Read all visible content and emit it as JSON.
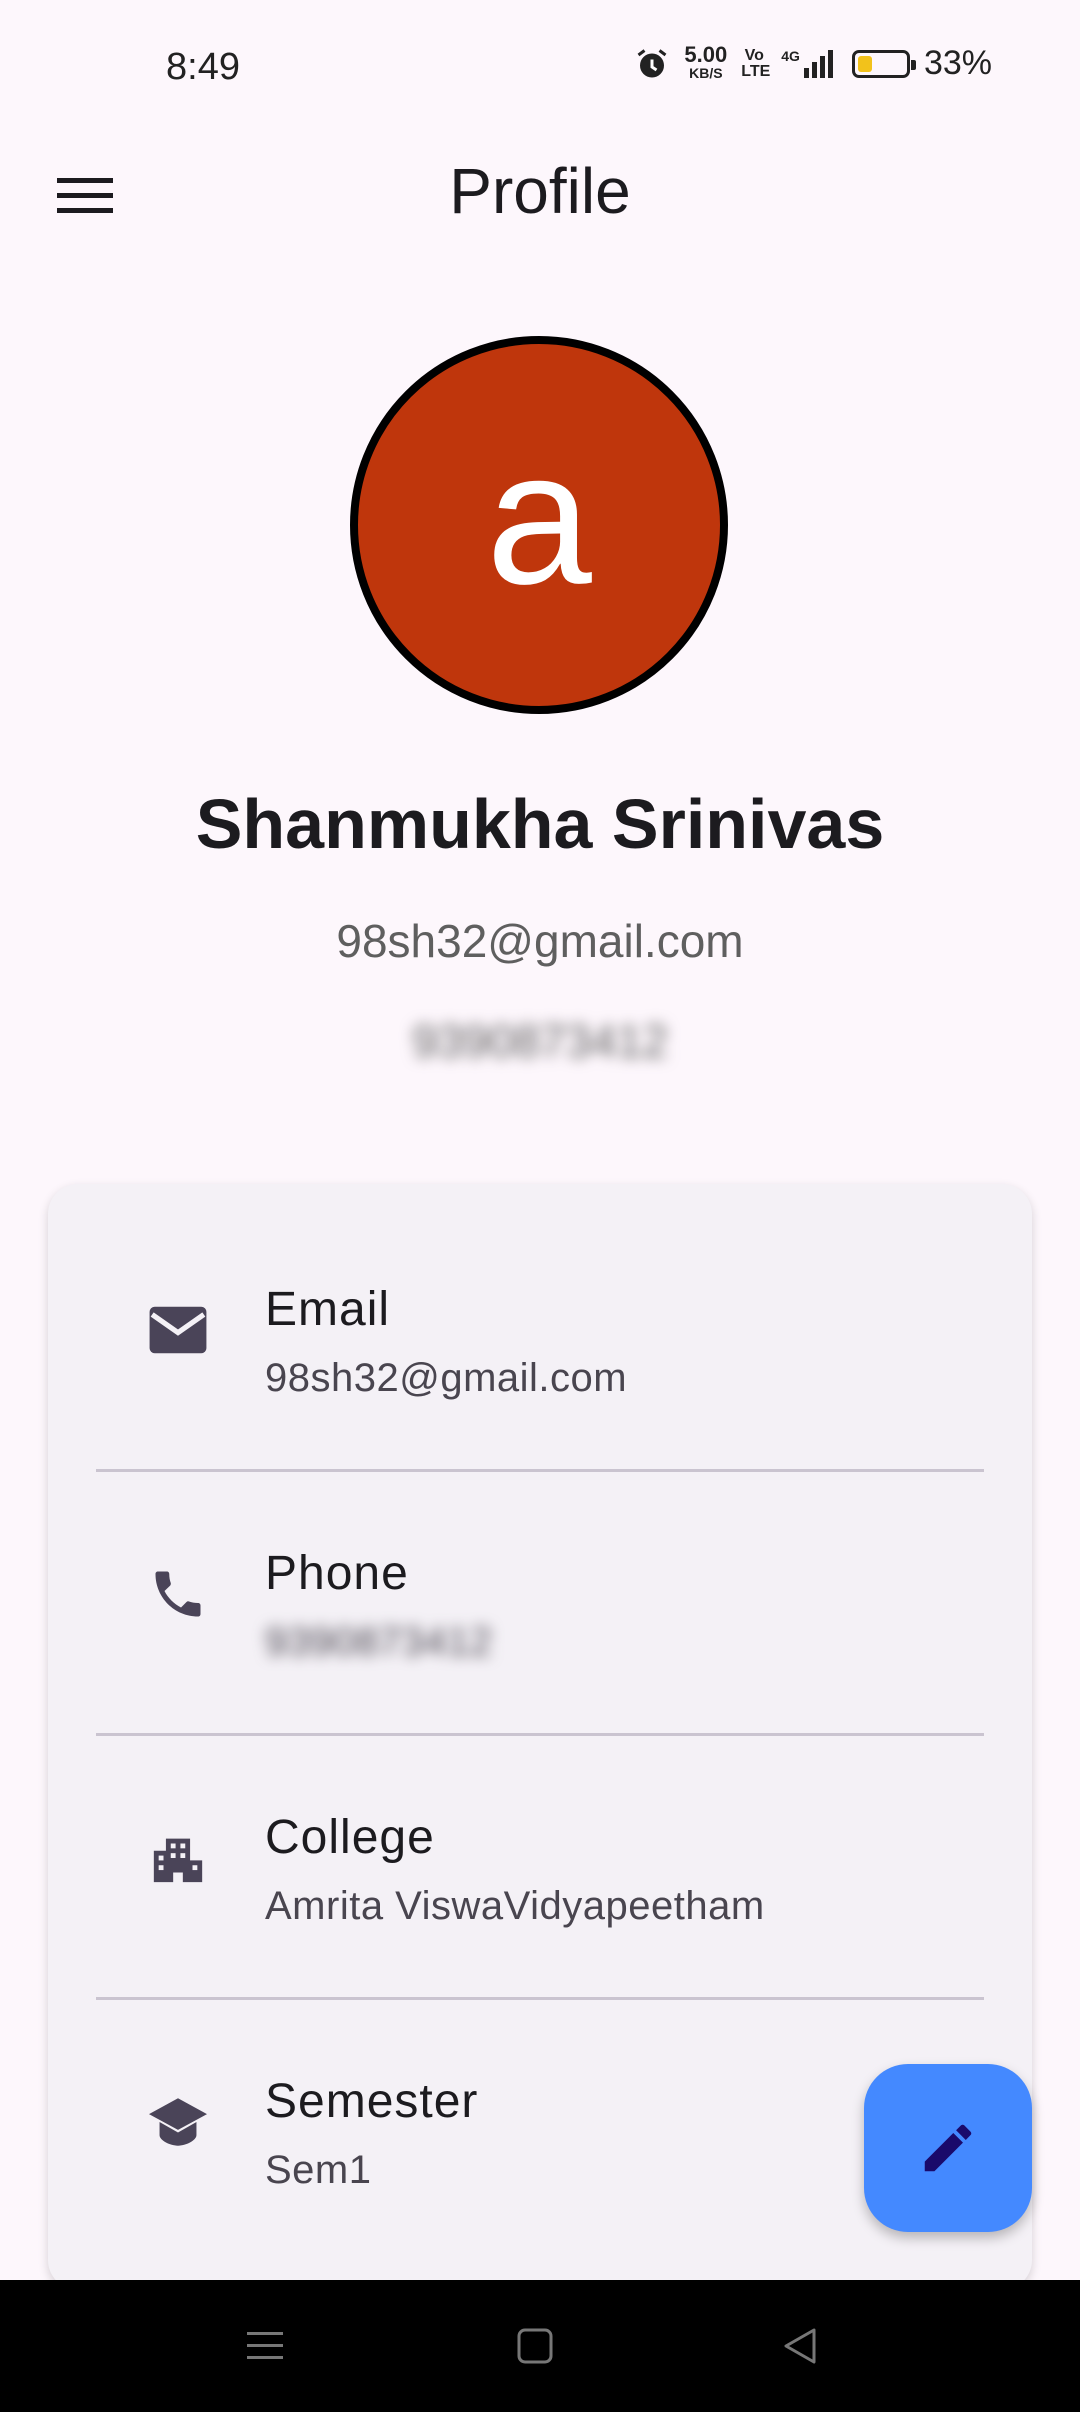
{
  "status_bar": {
    "time": "8:49",
    "net_speed_value": "5.00",
    "net_speed_unit": "KB/S",
    "volte": "Vo LTE",
    "network": "4G",
    "battery_percent": "33%",
    "battery_level": 0.33,
    "icons": [
      "alarm-icon",
      "signal-icon",
      "battery-icon"
    ]
  },
  "app_bar": {
    "title": "Profile",
    "menu_icon": "menu-icon"
  },
  "profile": {
    "avatar_letter": "a",
    "avatar_color": "#bf360c",
    "name": "Shanmukha Srinivas",
    "email": "98sh32@gmail.com",
    "phone": "9390873412"
  },
  "details": [
    {
      "icon": "mail-icon",
      "label": "Email",
      "value": "98sh32@gmail.com"
    },
    {
      "icon": "phone-icon",
      "label": "Phone",
      "value": "9390873412"
    },
    {
      "icon": "college-icon",
      "label": "College",
      "value": "Amrita ViswaVidyapeetham"
    },
    {
      "icon": "school-icon",
      "label": "Semester",
      "value": "Sem1"
    }
  ],
  "fab": {
    "icon": "edit-icon",
    "color": "#4489ff"
  },
  "nav_bar": {
    "buttons": [
      "recents-icon",
      "home-icon",
      "back-icon"
    ]
  }
}
